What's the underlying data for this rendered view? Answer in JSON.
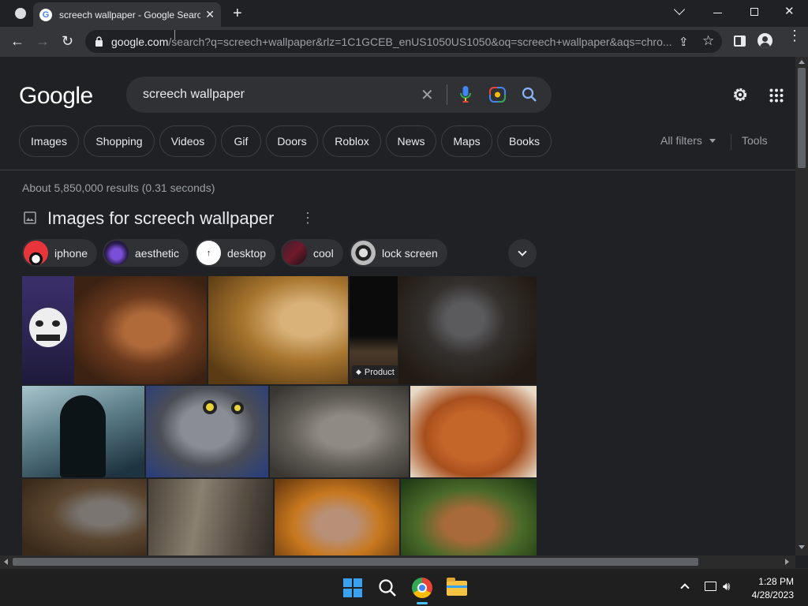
{
  "browser": {
    "tab_title": "screech wallpaper - Google Search",
    "url_host": "google.com",
    "url_rest": "/search?q=screech+wallpaper&rlz=1C1GCEB_enUS1050US1050&oq=screech+wallpaper&aqs=chro..."
  },
  "google": {
    "logo": "Google",
    "query": "screech wallpaper",
    "filters": [
      "Images",
      "Shopping",
      "Videos",
      "Gif",
      "Doors",
      "Roblox",
      "News",
      "Maps",
      "Books"
    ],
    "all_filters": "All filters",
    "tools": "Tools",
    "stats": "About 5,850,000 results (0.31 seconds)",
    "images_heading": "Images for screech wallpaper",
    "related": [
      "iphone",
      "aesthetic",
      "desktop",
      "cool",
      "lock screen"
    ],
    "product_badge": "Product"
  },
  "taskbar": {
    "time": "1:28 PM",
    "date": "4/28/2023"
  }
}
